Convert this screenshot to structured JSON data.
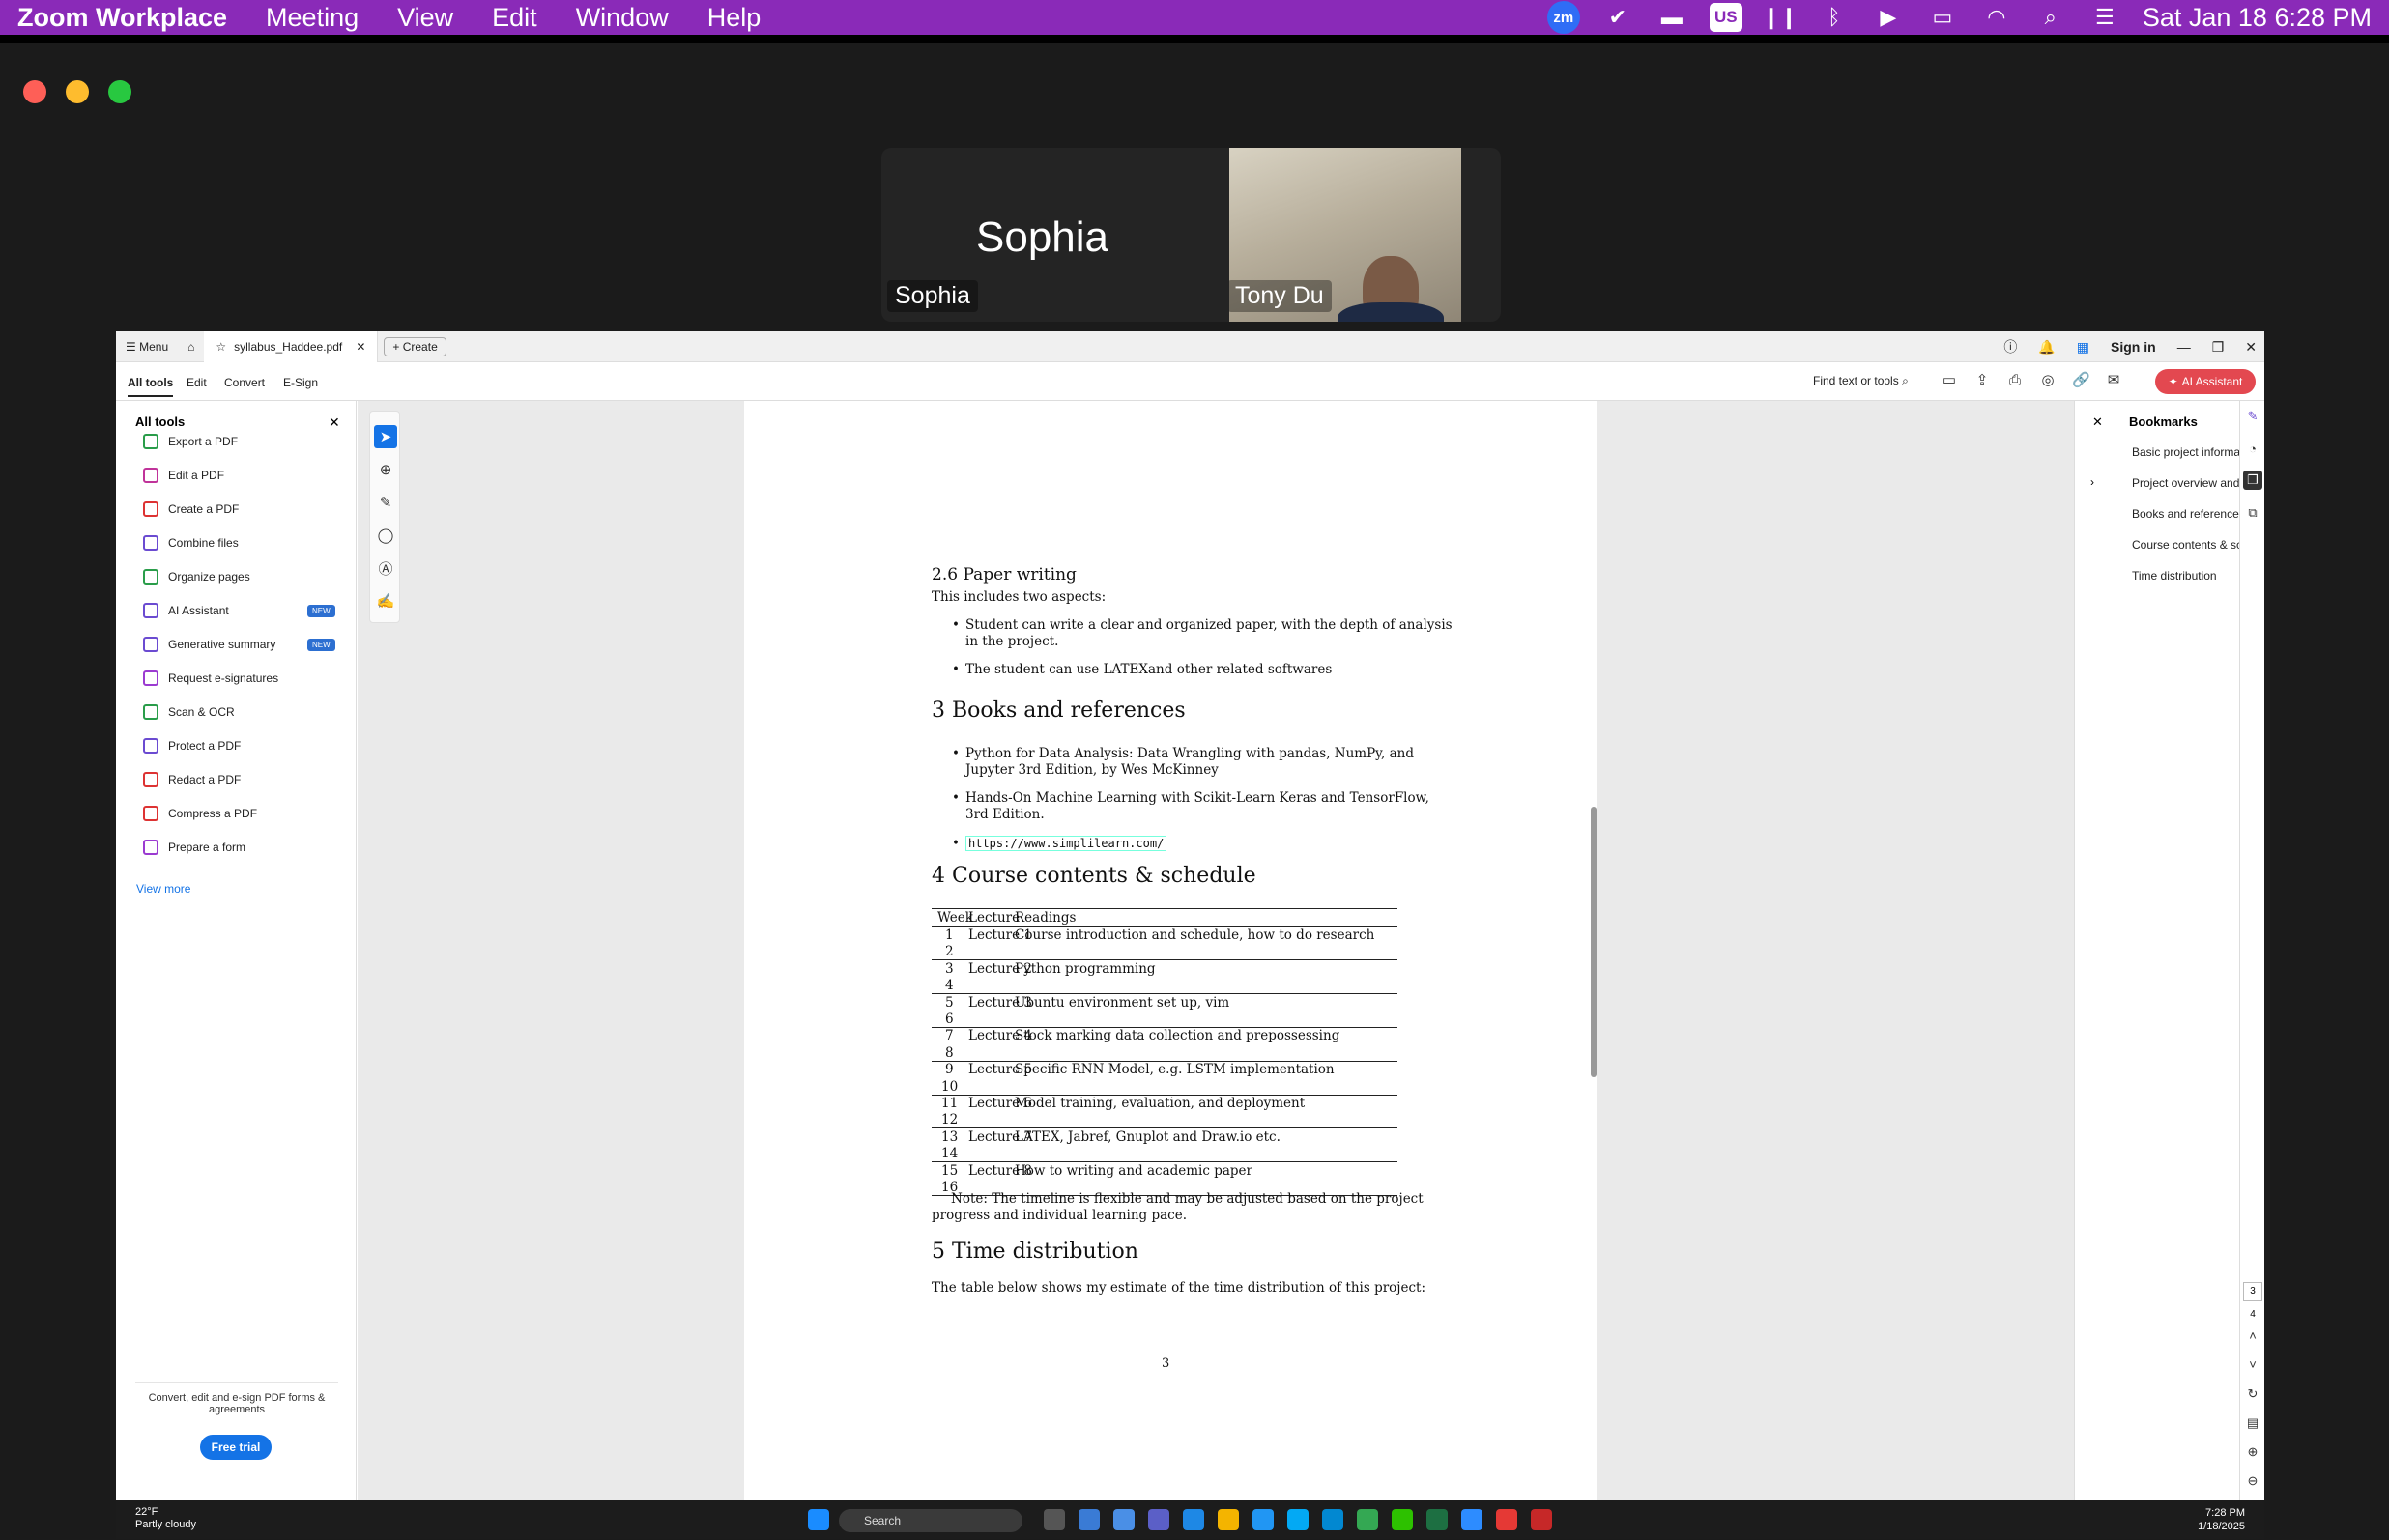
{
  "menubar": {
    "app": "Zoom Workplace",
    "items": [
      "Meeting",
      "View",
      "Edit",
      "Window",
      "Help"
    ],
    "clock": "Sat Jan 18  6:28 PM",
    "zoom_badge": "zm",
    "keyboard": "US"
  },
  "video": {
    "speaker_big": "Sophia",
    "tile1_label": "Sophia",
    "tile2_label": "Tony Du"
  },
  "acrobat": {
    "titlebar": {
      "menu": "Menu",
      "tab": "syllabus_Haddee.pdf",
      "create": "Create",
      "sign_in": "Sign in"
    },
    "toolbar": {
      "tabs": [
        "All tools",
        "Edit",
        "Convert",
        "E-Sign"
      ],
      "find": "Find text or tools",
      "ai": "AI Assistant"
    },
    "left_panel": {
      "title": "All tools",
      "tools": [
        "Export a PDF",
        "Edit a PDF",
        "Create a PDF",
        "Combine files",
        "Organize pages",
        "AI Assistant",
        "Generative summary",
        "Request e-signatures",
        "Scan & OCR",
        "Protect a PDF",
        "Redact a PDF",
        "Compress a PDF",
        "Prepare a form"
      ],
      "new_badge": "NEW",
      "view_more": "View more",
      "footer": "Convert, edit and e-sign PDF forms & agreements",
      "free_trial": "Free trial"
    },
    "bookmarks": {
      "title": "Bookmarks",
      "items": [
        "Basic project information",
        "Project overview and objectives",
        "Books and references",
        "Course contents & schedule",
        "Time distribution"
      ]
    },
    "rail": {
      "page": "3",
      "total": "4"
    }
  },
  "doc": {
    "s26_title": "2.6   Paper writing",
    "s26_intro": "This includes two aspects:",
    "s26_b1a": "Student can write a clear and organized paper, with the depth of analysis",
    "s26_b1b": "in the project.",
    "s26_b2": "The student can use LATEXand other related softwares",
    "s3_title": "3   Books and references",
    "s3_b1a": "Python for Data Analysis:  Data Wrangling with pandas, NumPy, and",
    "s3_b1b": "Jupyter 3rd Edition, by Wes McKinney",
    "s3_b2a": "Hands-On Machine Learning with Scikit-Learn Keras and TensorFlow,",
    "s3_b2b": "3rd Edition.",
    "s3_link": "https://www.simplilearn.com/",
    "s4_title": "4   Course contents & schedule",
    "table": {
      "headers": [
        "Week",
        "Lecture",
        "Readings"
      ],
      "rows": [
        [
          "1",
          "Lecture 1",
          "Course introduction and schedule, how to do research"
        ],
        [
          "2",
          "",
          ""
        ],
        [
          "3",
          "Lecture 2",
          "Python programming"
        ],
        [
          "4",
          "",
          ""
        ],
        [
          "5",
          "Lecture 3",
          "Ubuntu environment set up, vim"
        ],
        [
          "6",
          "",
          ""
        ],
        [
          "7",
          "Lecture 4",
          "Stock marking data collection and prepossessing"
        ],
        [
          "8",
          "",
          ""
        ],
        [
          "9",
          "Lecture 5",
          "Specific RNN Model, e.g. LSTM implementation"
        ],
        [
          "10",
          "",
          ""
        ],
        [
          "11",
          "Lecture 6",
          "Model training, evaluation, and deployment"
        ],
        [
          "12",
          "",
          ""
        ],
        [
          "13",
          "Lecture 7",
          "LATEX, Jabref, Gnuplot and Draw.io etc."
        ],
        [
          "14",
          "",
          ""
        ],
        [
          "15",
          "Lecture 8",
          "How to writing and academic paper"
        ],
        [
          "16",
          "",
          ""
        ]
      ]
    },
    "note_a": "Note:  The timeline is flexible and may be adjusted based on the project",
    "note_b": "progress and individual learning pace.",
    "s5_title": "5   Time distribution",
    "s5_text": "The table below shows my estimate of the time distribution of this project:",
    "page_number": "3"
  },
  "taskbar": {
    "temp": "22°F",
    "weather": "Partly cloudy",
    "search": "Search",
    "time": "7:28 PM",
    "date": "1/18/2025"
  }
}
